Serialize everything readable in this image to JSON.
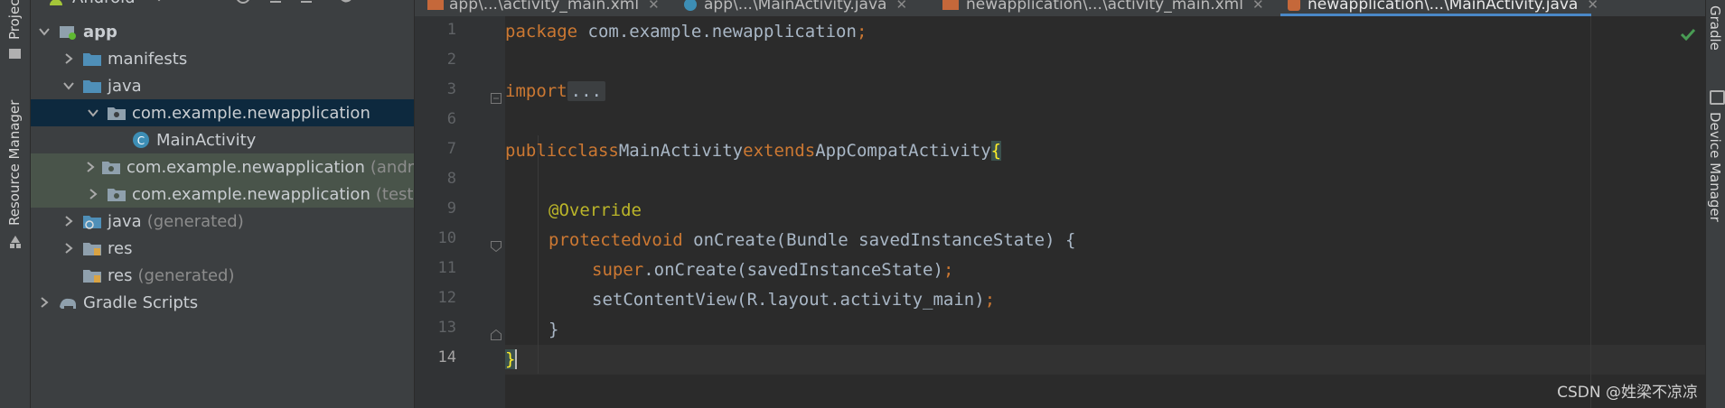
{
  "left_strip": {
    "project_label": "Project",
    "resource_label": "Resource Manager"
  },
  "right_strip": {
    "gradle_label": "Gradle",
    "device_label": "Device Manager"
  },
  "project_panel": {
    "view_selector": "Android",
    "tree": [
      {
        "label": "app",
        "suffix": "",
        "icon": "module-icon",
        "arrow": "down"
      },
      {
        "label": "manifests",
        "suffix": "",
        "icon": "folder-icon",
        "arrow": "right"
      },
      {
        "label": "java",
        "suffix": "",
        "icon": "folder-icon",
        "arrow": "down"
      },
      {
        "label": "com.example.newapplication",
        "suffix": "",
        "icon": "package-icon",
        "arrow": "down"
      },
      {
        "label": "MainActivity",
        "suffix": "",
        "icon": "class-icon",
        "arrow": ""
      },
      {
        "label": "com.example.newapplication",
        "suffix": "(androidTest)",
        "icon": "package-icon",
        "arrow": "right"
      },
      {
        "label": "com.example.newapplication",
        "suffix": "(test)",
        "icon": "package-icon",
        "arrow": "right"
      },
      {
        "label": "java",
        "suffix": "(generated)",
        "icon": "generated-folder-icon",
        "arrow": "right"
      },
      {
        "label": "res",
        "suffix": "",
        "icon": "res-folder-icon",
        "arrow": "right"
      },
      {
        "label": "res",
        "suffix": "(generated)",
        "icon": "res-folder-icon",
        "arrow": ""
      },
      {
        "label": "Gradle Scripts",
        "suffix": "",
        "icon": "gradle-elephant-icon",
        "arrow": "right"
      }
    ]
  },
  "tabs": [
    {
      "label": "app\\...\\activity_main.xml",
      "icon": "xml-file-icon"
    },
    {
      "label": "app\\...\\MainActivity.java",
      "icon": "class-file-icon"
    },
    {
      "label": "newapplication\\...\\activity_main.xml",
      "icon": "xml-file-icon"
    },
    {
      "label": "newapplication\\...\\MainActivity.java",
      "icon": "java-file-icon"
    }
  ],
  "editor": {
    "line_numbers": [
      "1",
      "2",
      "3",
      "6",
      "7",
      "8",
      "9",
      "10",
      "11",
      "12",
      "13",
      "14"
    ],
    "code": {
      "l1_kw": "package",
      "l1_rest": " com.example.newapplication",
      "l1_semi": ";",
      "l3_kw": "import",
      "l3_folded": "...",
      "l7_kw1": "public",
      "l7_kw2": "class",
      "l7_name": "MainActivity",
      "l7_kw3": "extends",
      "l7_super": "AppCompatActivity",
      "l7_brace": "{",
      "l9_ann": "@Override",
      "l10_kw1": "protected",
      "l10_kw2": "void",
      "l10_rest": " onCreate(Bundle savedInstanceState) {",
      "l11_kw": "super",
      "l11_rest": ".onCreate(savedInstanceState)",
      "l11_semi": ";",
      "l12_rest": "setContentView(R.layout.activity_main)",
      "l12_semi": ";",
      "l13_rest": "}",
      "l14_brace": "}"
    },
    "status_check": "no-problems-icon"
  },
  "watermark": "CSDN @姓梁不凉凉",
  "colors": {
    "keyword": "#cc7832",
    "annotation": "#bbb529",
    "selection": "#0d293e",
    "test_bg": "#49544a",
    "tab_underline": "#4a88c7"
  }
}
